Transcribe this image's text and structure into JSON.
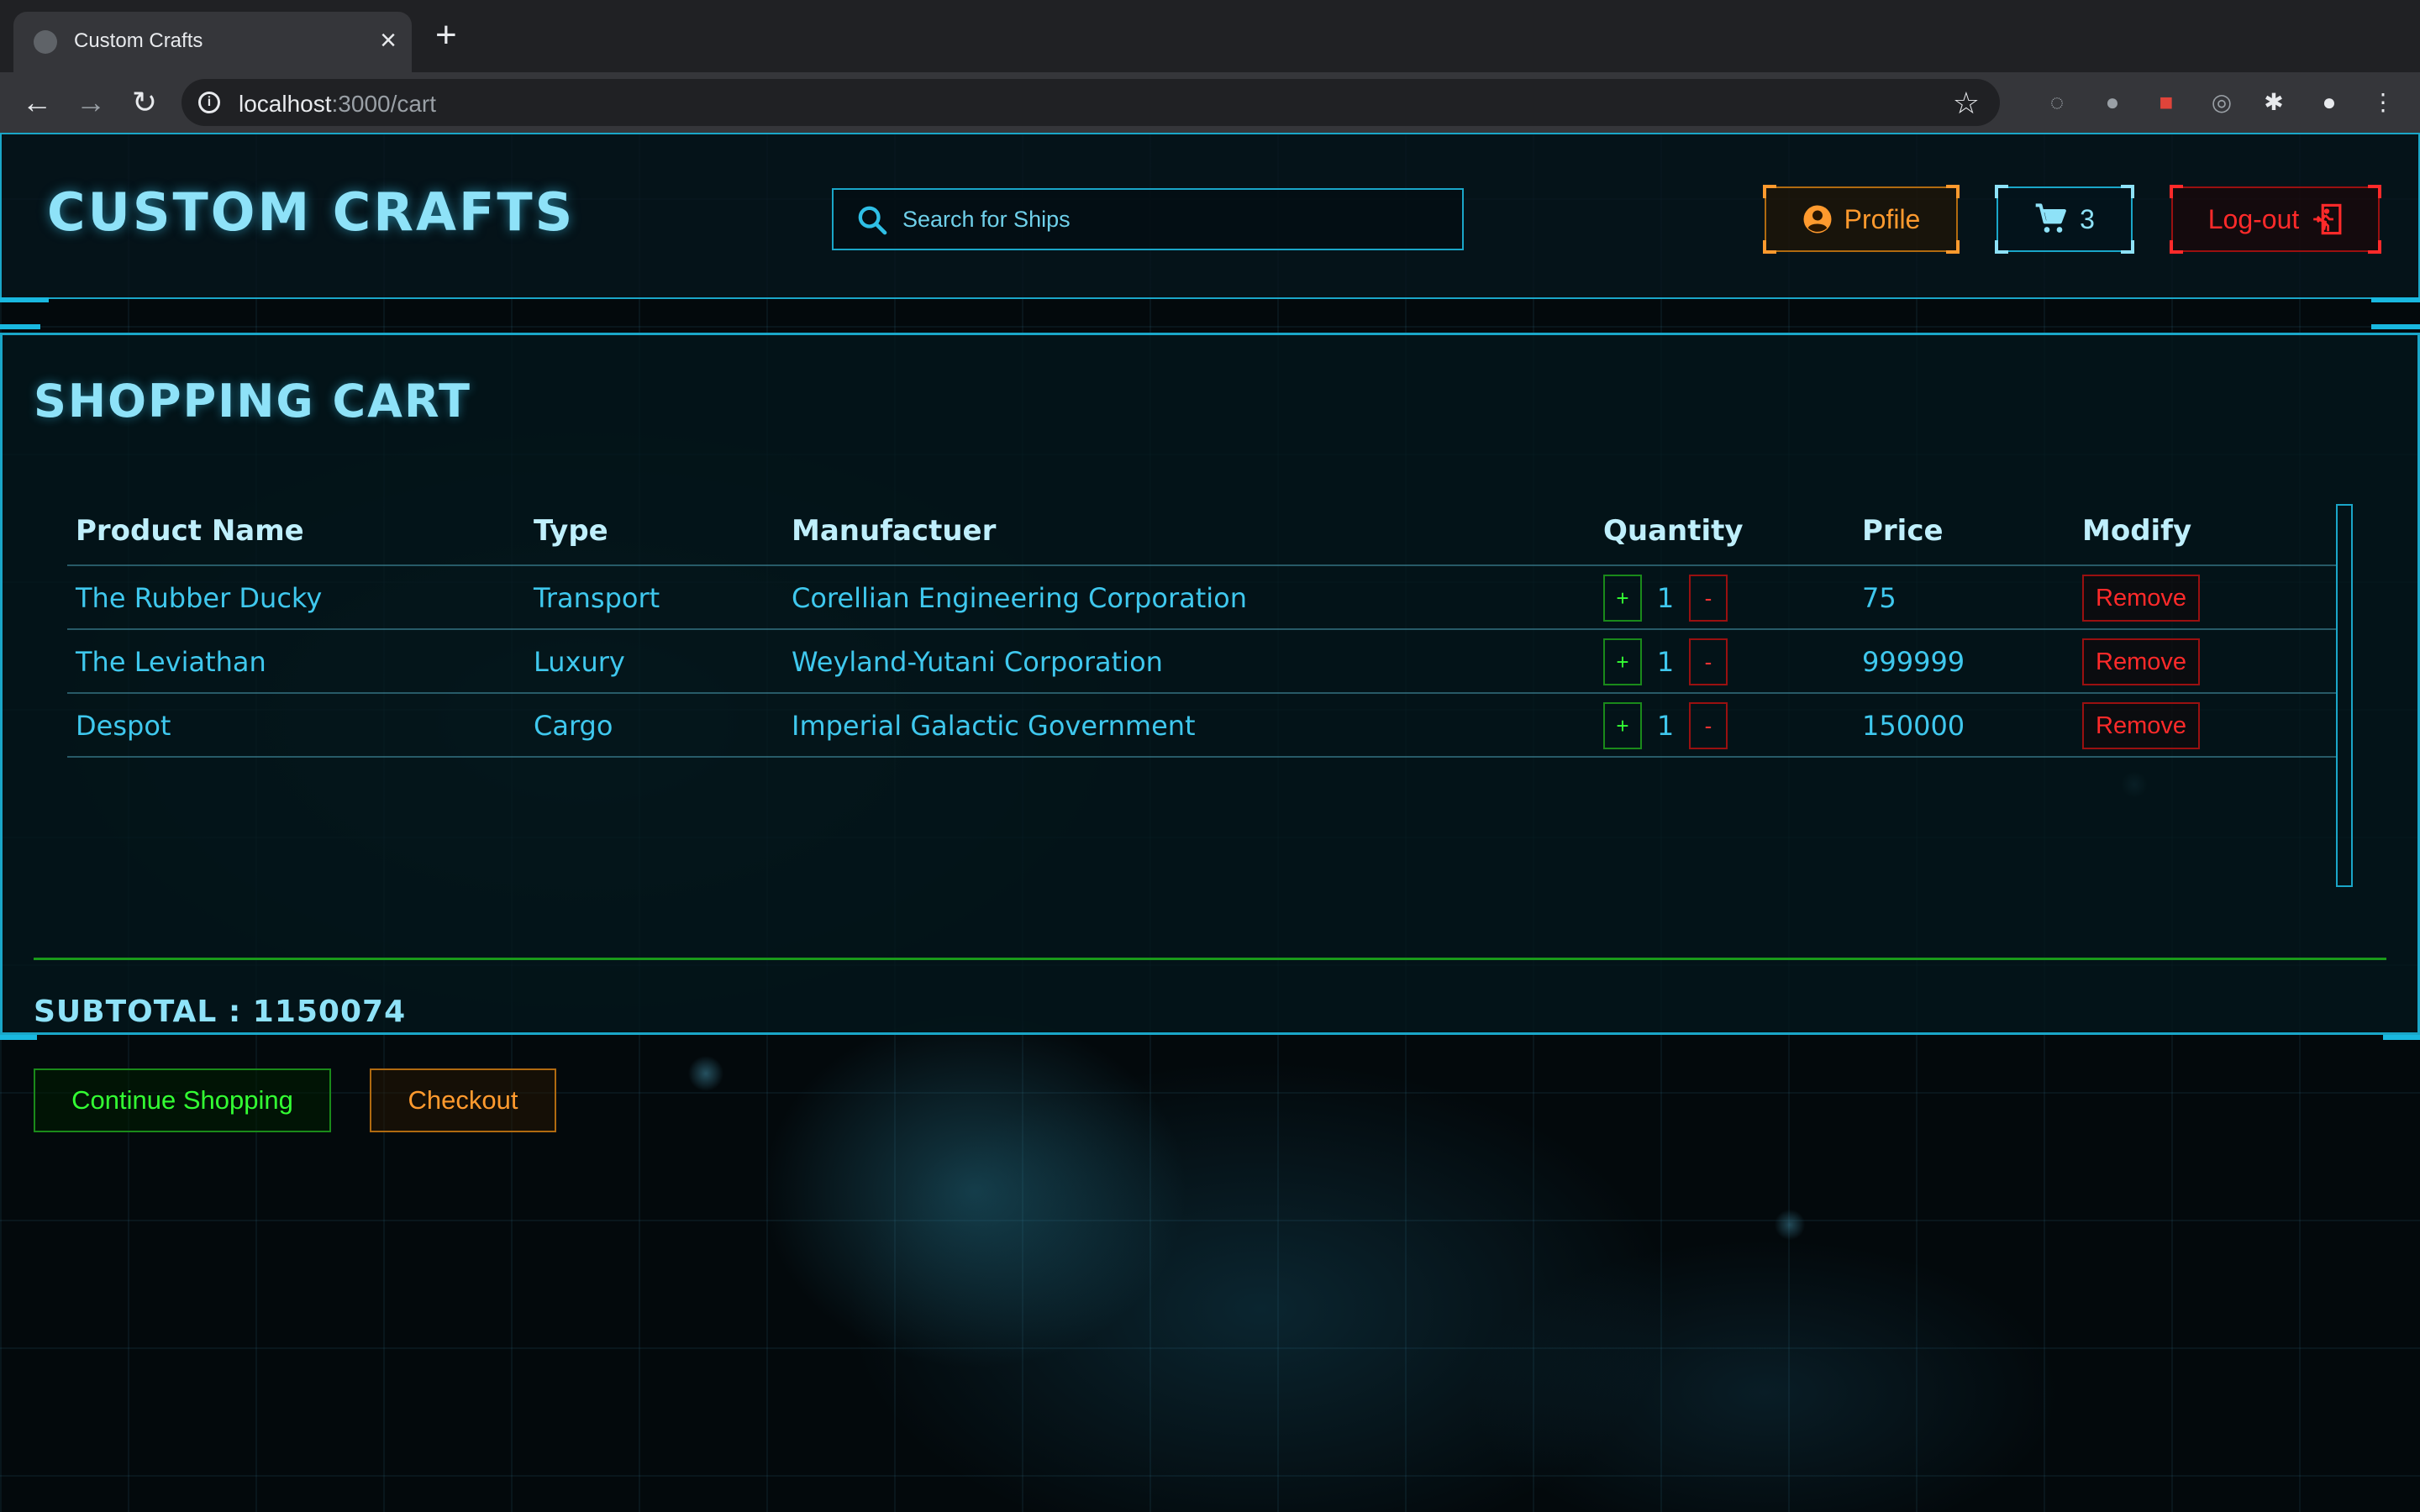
{
  "browser": {
    "tab_title": "Custom Crafts",
    "url_host": "localhost",
    "url_path": ":3000/cart"
  },
  "header": {
    "brand": "CUSTOM CRAFTS",
    "search_placeholder": "Search for Ships",
    "profile_label": "Profile",
    "cart_count": "3",
    "logout_label": "Log-out"
  },
  "cart": {
    "title": "SHOPPING CART",
    "columns": [
      "Product Name",
      "Type",
      "Manufactuer",
      "Quantity",
      "Price",
      "Modify"
    ],
    "rows": [
      {
        "name": "The Rubber Ducky",
        "type": "Transport",
        "manufacturer": "Corellian Engineering Corporation",
        "quantity": "1",
        "price": "75",
        "remove": "Remove"
      },
      {
        "name": "The Leviathan",
        "type": "Luxury",
        "manufacturer": "Weyland-Yutani Corporation",
        "quantity": "1",
        "price": "999999",
        "remove": "Remove"
      },
      {
        "name": "Despot",
        "type": "Cargo",
        "manufacturer": "Imperial Galactic Government",
        "quantity": "1",
        "price": "150000",
        "remove": "Remove"
      }
    ],
    "plus_label": "+",
    "minus_label": "-",
    "subtotal": "SUBTOTAL : 1150074",
    "continue_label": "Continue Shopping",
    "checkout_label": "Checkout"
  },
  "colors": {
    "accent_cyan": "#1aa6c8",
    "text_cyan": "#3fc8ee",
    "orange": "#ff9a2e",
    "red": "#ff2a2a",
    "green": "#33ff33"
  },
  "icons": [
    "globe-icon",
    "close-icon",
    "plus-icon",
    "back-icon",
    "forward-icon",
    "reload-icon",
    "info-icon",
    "star-icon",
    "extension-icon",
    "account-icon",
    "menu-icon",
    "search-icon",
    "user-circle-icon",
    "cart-icon",
    "exit-icon"
  ]
}
